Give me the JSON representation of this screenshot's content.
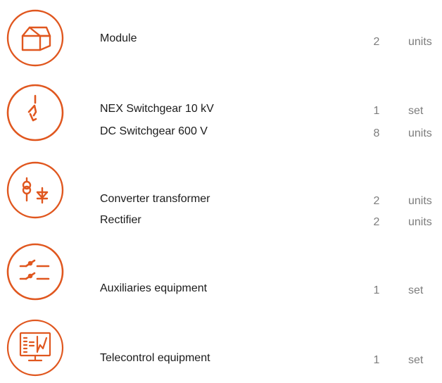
{
  "colors": {
    "accent": "#e0571f",
    "text": "#1b1b1b",
    "muted": "#7d7d7d"
  },
  "groups": [
    {
      "icon": "module-box-icon",
      "items": [
        {
          "name": "Module",
          "qty": "2",
          "unit": "units"
        }
      ]
    },
    {
      "icon": "switchgear-icon",
      "items": [
        {
          "name": "NEX Switchgear 10 kV",
          "qty": "1",
          "unit": "set"
        },
        {
          "name": "DC Switchgear 600 V",
          "qty": "8",
          "unit": "units"
        }
      ]
    },
    {
      "icon": "transformer-rectifier-icon",
      "items": [
        {
          "name": "Converter transformer",
          "qty": "2",
          "unit": "units"
        },
        {
          "name": "Rectifier",
          "qty": "2",
          "unit": "units"
        }
      ]
    },
    {
      "icon": "auxiliaries-switch-icon",
      "items": [
        {
          "name": "Auxiliaries equipment",
          "qty": "1",
          "unit": "set"
        }
      ]
    },
    {
      "icon": "telecontrol-monitor-icon",
      "items": [
        {
          "name": "Telecontrol equipment",
          "qty": "1",
          "unit": "set"
        }
      ]
    }
  ]
}
